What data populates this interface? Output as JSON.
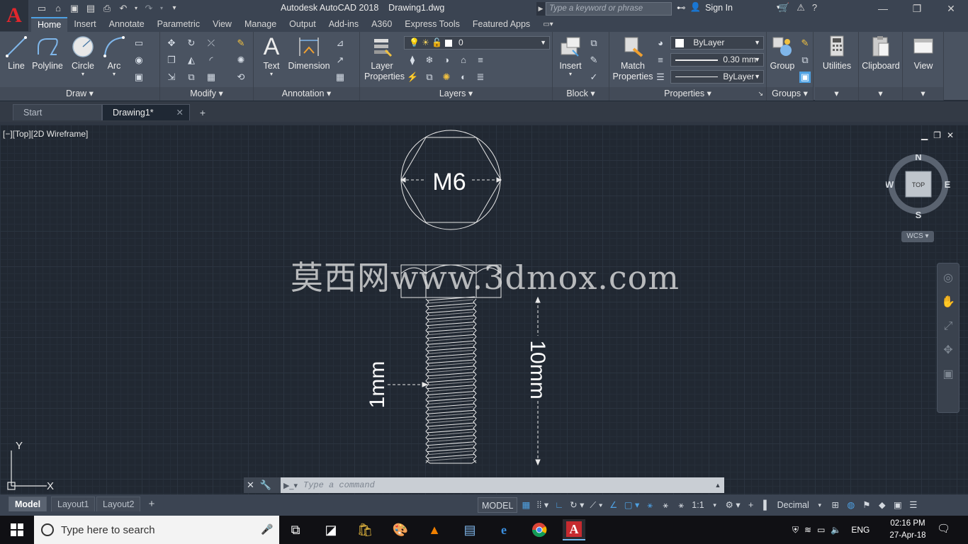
{
  "app": {
    "logo_letter": "A",
    "title": "Autodesk AutoCAD 2018    Drawing1.dwg",
    "search_placeholder": "Type a keyword or phrase",
    "sign_in": "Sign In"
  },
  "ribbon_tabs": [
    {
      "label": "Home",
      "active": true
    },
    {
      "label": "Insert"
    },
    {
      "label": "Annotate"
    },
    {
      "label": "Parametric"
    },
    {
      "label": "View"
    },
    {
      "label": "Manage"
    },
    {
      "label": "Output"
    },
    {
      "label": "Add-ins"
    },
    {
      "label": "A360"
    },
    {
      "label": "Express Tools"
    },
    {
      "label": "Featured Apps"
    }
  ],
  "ribbon": {
    "draw": {
      "title": "Draw",
      "line": "Line",
      "polyline": "Polyline",
      "circle": "Circle",
      "arc": "Arc"
    },
    "modify": {
      "title": "Modify"
    },
    "annotation": {
      "title": "Annotation",
      "text": "Text",
      "dimension": "Dimension"
    },
    "layers": {
      "title": "Layers",
      "layer_properties_1": "Layer",
      "layer_properties_2": "Properties",
      "current_layer": "0"
    },
    "block": {
      "title": "Block",
      "insert": "Insert"
    },
    "properties": {
      "title": "Properties",
      "match_1": "Match",
      "match_2": "Properties",
      "color": "ByLayer",
      "lineweight": "0.30 mm",
      "linetype": "ByLayer"
    },
    "groups": {
      "title": "Groups",
      "group": "Group"
    },
    "utilities": "Utilities",
    "clipboard": "Clipboard",
    "view": "View"
  },
  "file_tabs": [
    {
      "label": "Start"
    },
    {
      "label": "Drawing1*",
      "active": true
    }
  ],
  "viewport": {
    "label": "[−][Top][2D Wireframe]",
    "watermark": "莫西网www.3dmox.com"
  },
  "drawing_text": {
    "bolt_size": "M6",
    "pitch_dim": "1mm",
    "length_dim": "10mm"
  },
  "viewcube": {
    "n": "N",
    "s": "S",
    "e": "E",
    "w": "W",
    "face": "TOP",
    "wcs": "WCS"
  },
  "ucs": {
    "x": "X",
    "y": "Y"
  },
  "command_line": {
    "placeholder": "Type a command"
  },
  "layout_tabs": [
    {
      "label": "Model",
      "active": true
    },
    {
      "label": "Layout1"
    },
    {
      "label": "Layout2"
    }
  ],
  "status": {
    "model": "MODEL",
    "scale": "1:1",
    "units": "Decimal"
  },
  "taskbar": {
    "search_placeholder": "Type here to search",
    "language": "ENG",
    "time": "02:16 PM",
    "date": "27-Apr-18"
  },
  "colors": {
    "canvas": "#212832",
    "ribbon": "#4a5361",
    "accent": "#4ea1e3",
    "autocad_red": "#e1262c"
  }
}
